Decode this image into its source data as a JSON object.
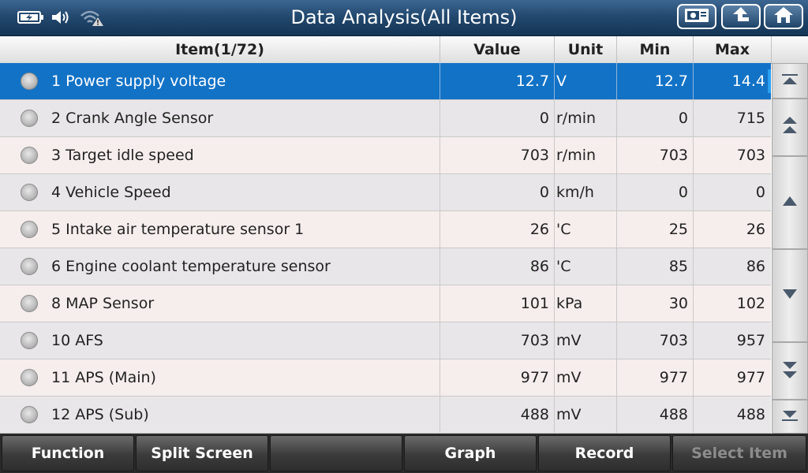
{
  "header": {
    "title": "Data Analysis(All Items)",
    "status_icons": [
      "battery-charging-icon",
      "speaker-icon",
      "wifi-warning-icon"
    ],
    "buttons": [
      "screenshot-icon",
      "back-arrow-icon",
      "home-icon"
    ]
  },
  "table": {
    "columns": {
      "item": "Item(1/72)",
      "value": "Value",
      "unit": "Unit",
      "min": "Min",
      "max": "Max"
    },
    "selected_index": 0,
    "rows": [
      {
        "name": "1 Power supply voltage",
        "value": "12.7",
        "unit": "V",
        "min": "12.7",
        "max": "14.4"
      },
      {
        "name": "2 Crank Angle Sensor",
        "value": "0",
        "unit": "r/min",
        "min": "0",
        "max": "715"
      },
      {
        "name": "3 Target idle speed",
        "value": "703",
        "unit": "r/min",
        "min": "703",
        "max": "703"
      },
      {
        "name": "4 Vehicle Speed",
        "value": "0",
        "unit": "km/h",
        "min": "0",
        "max": "0"
      },
      {
        "name": "5 Intake air temperature sensor 1",
        "value": "26",
        "unit": "'C",
        "min": "25",
        "max": "26"
      },
      {
        "name": "6 Engine coolant temperature sensor",
        "value": "86",
        "unit": "'C",
        "min": "85",
        "max": "86"
      },
      {
        "name": "8 MAP Sensor",
        "value": "101",
        "unit": "kPa",
        "min": "30",
        "max": "102"
      },
      {
        "name": "10 AFS",
        "value": "703",
        "unit": "mV",
        "min": "703",
        "max": "957"
      },
      {
        "name": "11 APS (Main)",
        "value": "977",
        "unit": "mV",
        "min": "977",
        "max": "977"
      },
      {
        "name": "12 APS (Sub)",
        "value": "488",
        "unit": "mV",
        "min": "488",
        "max": "488"
      }
    ]
  },
  "scroll_buttons": [
    "scroll-top-icon",
    "page-up-icon",
    "line-up-icon",
    "line-down-icon",
    "page-down-icon",
    "scroll-bottom-icon"
  ],
  "footer": {
    "buttons": [
      {
        "label": "Function",
        "enabled": true
      },
      {
        "label": "Split Screen",
        "enabled": true
      },
      {
        "label": "",
        "enabled": true
      },
      {
        "label": "Graph",
        "enabled": true
      },
      {
        "label": "Record",
        "enabled": true
      },
      {
        "label": "Select Item",
        "enabled": false
      }
    ]
  },
  "colors": {
    "titlebar": "#23496f",
    "selected_row": "#1272c6",
    "odd_row": "#f6eeec",
    "even_row": "#e8e6e8",
    "scroll_indicator": "#2aa0f0"
  }
}
